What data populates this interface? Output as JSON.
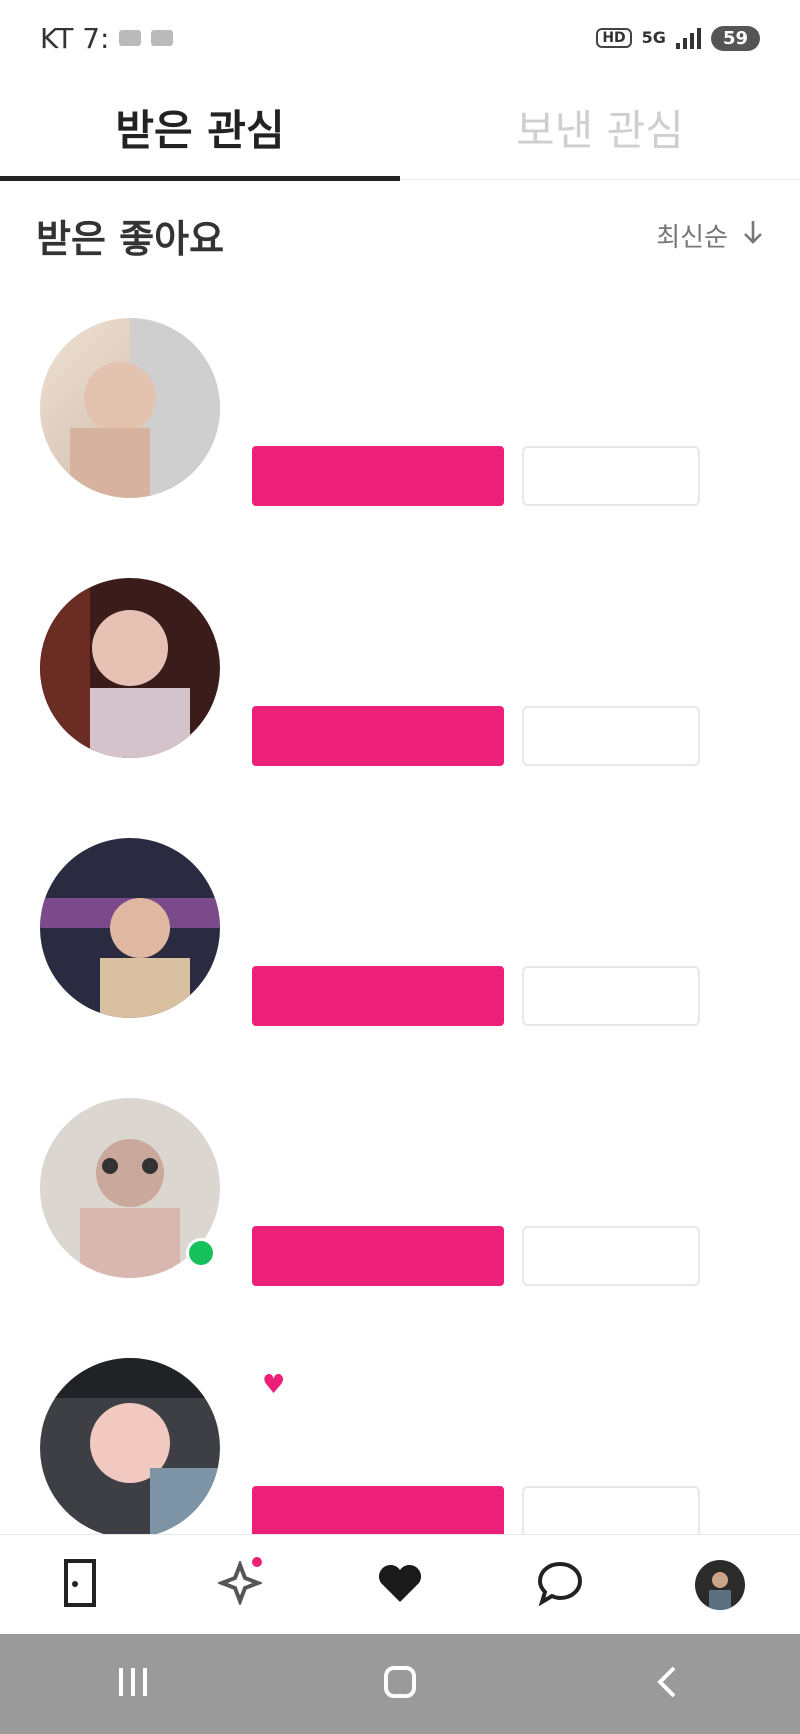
{
  "status_bar": {
    "carrier_time": "KT 7:",
    "battery": "59",
    "hd": "HD",
    "network": "5G"
  },
  "tabs": [
    {
      "label": "받은 관심",
      "active": true
    },
    {
      "label": "보낸 관심",
      "active": false
    }
  ],
  "section": {
    "title": "받은 좋아요",
    "sort_label": "최신순"
  },
  "items": [
    {
      "name": "",
      "meta": "",
      "accept_label": "",
      "reject_label": "",
      "online": false,
      "avatar_colors": [
        "#e9d8c8",
        "#c9b8a8",
        "#7a6a62"
      ]
    },
    {
      "name": "",
      "meta": "",
      "accept_label": "",
      "reject_label": "",
      "online": false,
      "avatar_colors": [
        "#5a2a28",
        "#d9c3c7",
        "#2a1a1a"
      ]
    },
    {
      "name": "",
      "meta": "",
      "accept_label": "",
      "reject_label": "",
      "online": false,
      "avatar_colors": [
        "#2c2c44",
        "#c0a090",
        "#6a4a7a"
      ]
    },
    {
      "name": "",
      "meta": "",
      "accept_label": "",
      "reject_label": "",
      "online": true,
      "avatar_colors": [
        "#d9d2cc",
        "#b7a9a5",
        "#8a7a78"
      ]
    },
    {
      "name": "",
      "meta": "",
      "accept_label": "",
      "reject_label": "",
      "online": false,
      "avatar_colors": [
        "#3a3a3a",
        "#f0c7c0",
        "#7a8ea0"
      ]
    }
  ],
  "colors": {
    "accent": "#ec2079",
    "online": "#16c05a",
    "system_nav": "#9a9a9a"
  },
  "bottom_nav": [
    {
      "icon": "door-icon"
    },
    {
      "icon": "sparkle-icon",
      "badge": true
    },
    {
      "icon": "heart-icon"
    },
    {
      "icon": "chat-bubble-icon"
    },
    {
      "icon": "profile-avatar"
    }
  ],
  "system_nav": [
    {
      "icon": "recent-apps-icon"
    },
    {
      "icon": "home-icon"
    },
    {
      "icon": "back-icon"
    }
  ]
}
